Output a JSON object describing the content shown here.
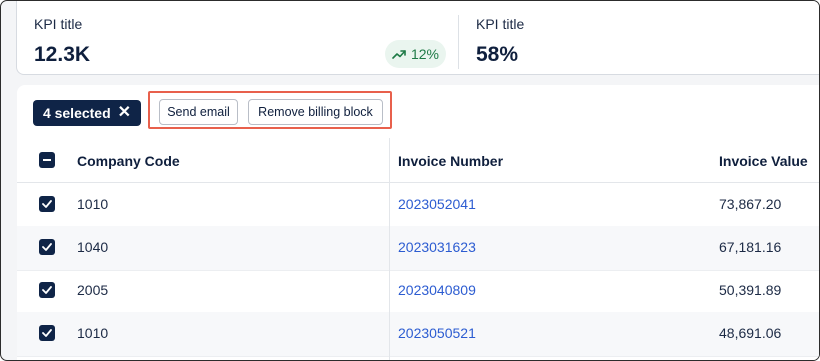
{
  "kpis": [
    {
      "title": "KPI title",
      "value": "12.3K",
      "trend": {
        "icon": "trend-up-icon",
        "value": "12%"
      }
    },
    {
      "title": "KPI title",
      "value": "58%"
    }
  ],
  "selection": {
    "label": "4 selected",
    "close_icon": "close-icon"
  },
  "actions": {
    "send_email": "Send email",
    "remove_billing_block": "Remove billing block"
  },
  "table": {
    "columns": [
      "Company Code",
      "Invoice Number",
      "Invoice Value"
    ],
    "rows": [
      {
        "company_code": "1010",
        "invoice_number": "2023052041",
        "invoice_value": "73,867.20",
        "selected": true
      },
      {
        "company_code": "1040",
        "invoice_number": "2023031623",
        "invoice_value": "67,181.16",
        "selected": true
      },
      {
        "company_code": "2005",
        "invoice_number": "2023040809",
        "invoice_value": "50,391.89",
        "selected": true
      },
      {
        "company_code": "1010",
        "invoice_number": "2023050521",
        "invoice_value": "48,691.06",
        "selected": true
      }
    ]
  },
  "colors": {
    "primary_dark": "#0f2447",
    "link": "#2c5cd1",
    "trend_positive": "#1e7a46",
    "highlight": "#e8604c"
  }
}
